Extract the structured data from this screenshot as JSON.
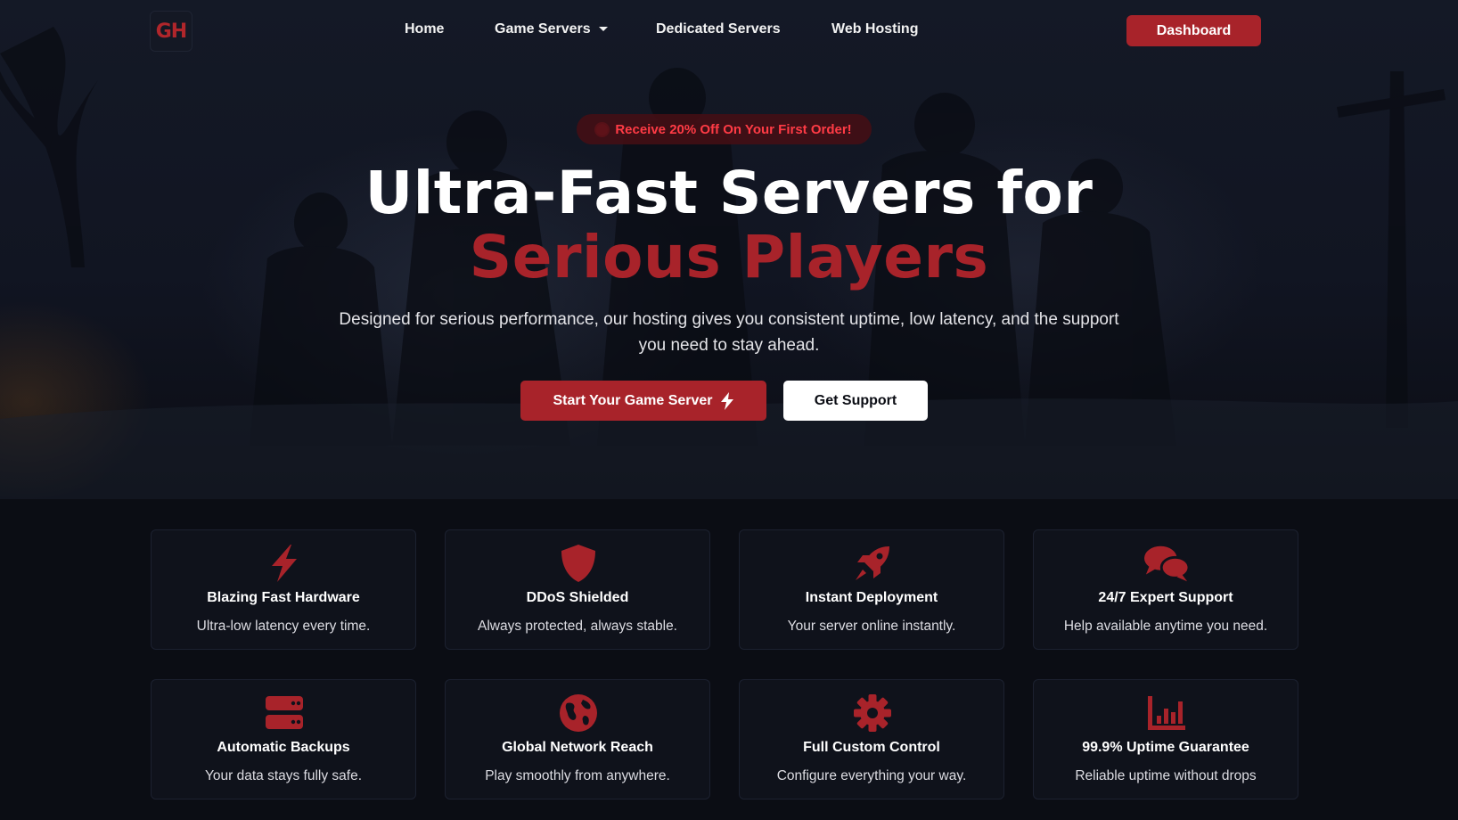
{
  "brand": {
    "logo_text": "GH"
  },
  "nav": {
    "items": [
      {
        "label": "Home"
      },
      {
        "label": "Game Servers"
      },
      {
        "label": "Dedicated Servers"
      },
      {
        "label": "Web Hosting"
      }
    ],
    "dashboard_label": "Dashboard"
  },
  "hero": {
    "promo": "Receive 20% Off On Your First Order!",
    "headline_line1": "Ultra-Fast Servers for",
    "headline_line2": "Serious Players",
    "subtext": "Designed for serious performance, our hosting gives you consistent uptime, low latency, and the support you need to stay ahead.",
    "primary_cta": "Start Your Game Server",
    "secondary_cta": "Get Support"
  },
  "features": [
    {
      "icon": "bolt-icon",
      "title": "Blazing Fast Hardware",
      "desc": "Ultra-low latency every time."
    },
    {
      "icon": "shield-icon",
      "title": "DDoS Shielded",
      "desc": "Always protected, always stable."
    },
    {
      "icon": "rocket-icon",
      "title": "Instant Deployment",
      "desc": "Your server online instantly."
    },
    {
      "icon": "chat-bubbles-icon",
      "title": "24/7 Expert Support",
      "desc": "Help available anytime you need."
    },
    {
      "icon": "server-icon",
      "title": "Automatic Backups",
      "desc": "Your data stays fully safe."
    },
    {
      "icon": "globe-icon",
      "title": "Global Network Reach",
      "desc": "Play smoothly from anywhere."
    },
    {
      "icon": "gear-icon",
      "title": "Full Custom Control",
      "desc": "Configure everything your way."
    },
    {
      "icon": "bar-chart-icon",
      "title": "99.9% Uptime Guarantee",
      "desc": "Reliable uptime without drops"
    }
  ],
  "colors": {
    "accent": "#a8232a",
    "background": "#0b0d14",
    "card": "#0f121b",
    "promo_text": "#ff3b45"
  }
}
